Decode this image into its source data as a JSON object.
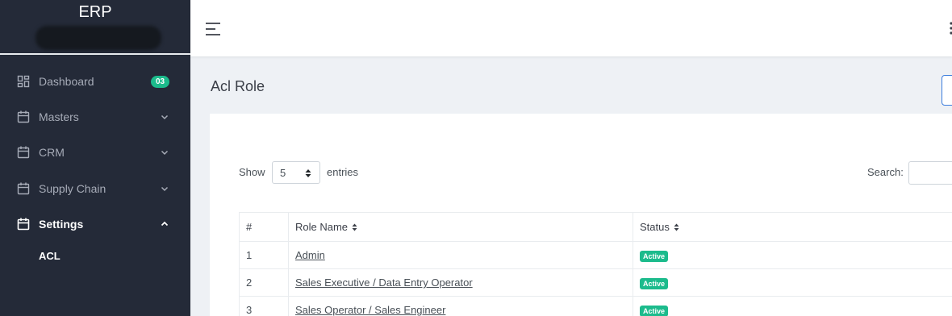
{
  "brand": {
    "title": "ERP"
  },
  "sidebar": {
    "items": [
      {
        "label": "Dashboard",
        "icon": "dashboard-icon",
        "badge": "03"
      },
      {
        "label": "Masters",
        "icon": "calendar-icon"
      },
      {
        "label": "CRM",
        "icon": "calendar-icon"
      },
      {
        "label": "Supply Chain",
        "icon": "calendar-icon"
      },
      {
        "label": "Settings",
        "icon": "calendar-icon",
        "expanded": true
      }
    ],
    "sub_items": [
      {
        "label": "ACL"
      }
    ]
  },
  "page": {
    "title": "Acl Role"
  },
  "table_controls": {
    "show_label": "Show",
    "page_length": "5",
    "entries_label": "entries",
    "search_label": "Search:",
    "search_value": ""
  },
  "table": {
    "headers": [
      "#",
      "Role Name",
      "Status"
    ],
    "rows": [
      {
        "num": "1",
        "role": "Admin",
        "status": "Active"
      },
      {
        "num": "2",
        "role": "Sales Executive / Data Entry Operator",
        "status": "Active"
      },
      {
        "num": "3",
        "role": "Sales Operator / Sales Engineer",
        "status": "Active"
      }
    ]
  },
  "colors": {
    "sidebar_bg": "#242a38",
    "accent_green": "#1cbb8c",
    "content_bg": "#eef1f5",
    "primary_blue": "#3b7ddd"
  }
}
